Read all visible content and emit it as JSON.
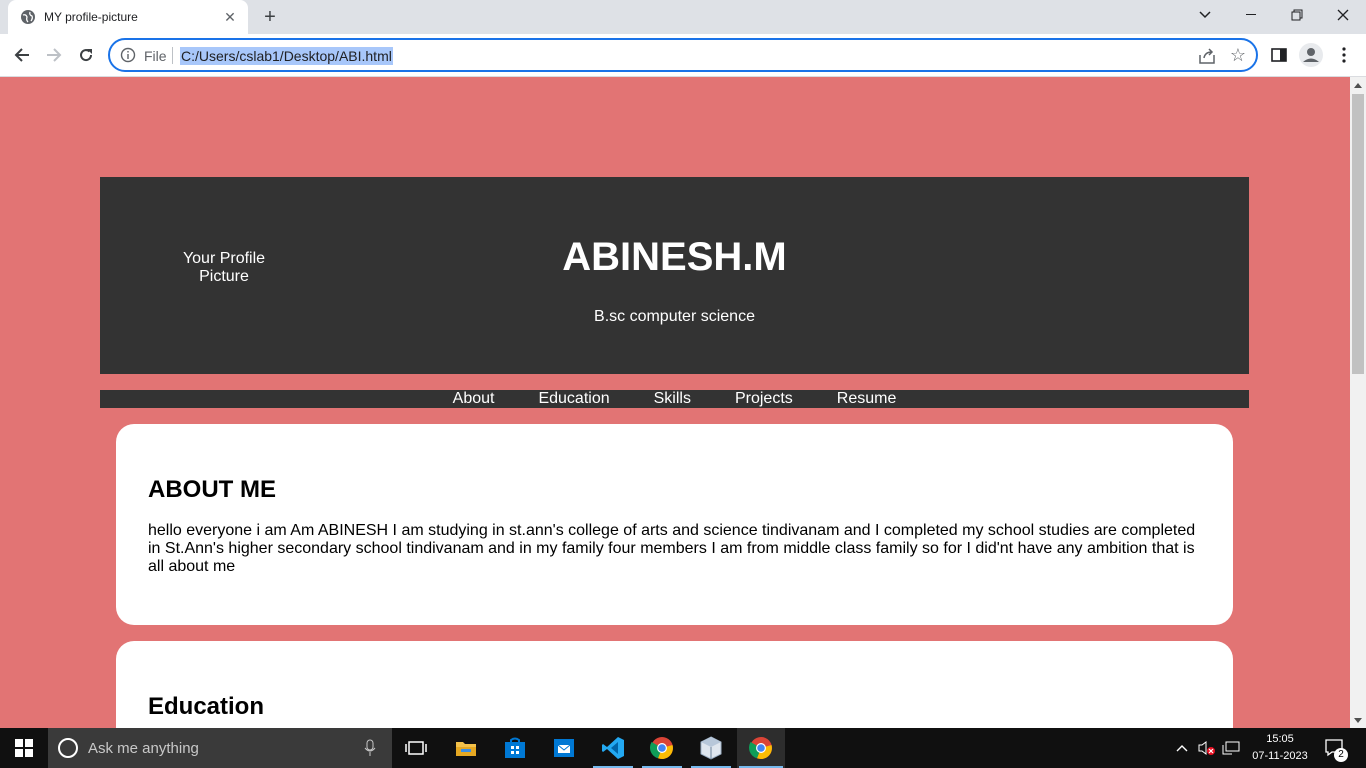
{
  "browser": {
    "tab_title": "MY profile-picture",
    "scheme_label": "File",
    "url": "C:/Users/cslab1/Desktop/ABI.html",
    "accent": "#1a73e8"
  },
  "page": {
    "background": "#e27474",
    "header": {
      "profile_pic_line1": "Your Profile",
      "profile_pic_line2": "Picture",
      "name": "ABINESH.M",
      "subtitle": "B.sc computer science"
    },
    "nav": [
      "About",
      "Education",
      "Skills",
      "Projects",
      "Resume"
    ],
    "about": {
      "heading": "ABOUT ME",
      "text": "hello everyone i am Am ABINESH I am studying in st.ann's college of arts and science tindivanam and I completed my school studies are completed in St.Ann's higher secondary school tindivanam and in my family four members I am from middle class family so for I did'nt have any ambition that is all about me"
    },
    "education": {
      "heading": "Education"
    }
  },
  "taskbar": {
    "search_placeholder": "Ask me anything",
    "time": "15:05",
    "date": "07-11-2023",
    "notification_count": "2",
    "icons": [
      "task-view-icon",
      "file-explorer-icon",
      "store-icon",
      "mail-icon",
      "vscode-icon",
      "chrome-icon",
      "virtualbox-icon",
      "chrome-icon"
    ]
  }
}
